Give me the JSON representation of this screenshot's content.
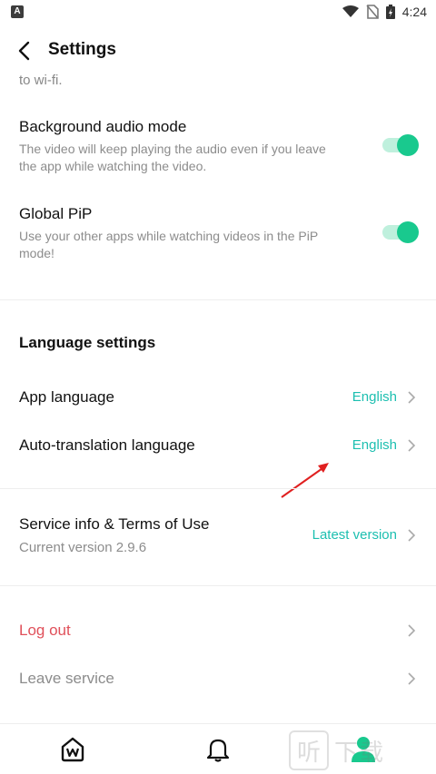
{
  "status_bar": {
    "time": "4:24",
    "left_icon": "A"
  },
  "header": {
    "title": "Settings"
  },
  "cutoff_text": "to wi-fi.",
  "settings": [
    {
      "title": "Background audio mode",
      "desc": "The video will keep playing the audio even if you leave the app while watching the video.",
      "on": true
    },
    {
      "title": "Global PiP",
      "desc": "Use your other apps while watching videos in the PiP mode!",
      "on": true
    }
  ],
  "language": {
    "heading": "Language settings",
    "app_language": {
      "label": "App language",
      "value": "English"
    },
    "auto_translation": {
      "label": "Auto-translation language",
      "value": "English"
    }
  },
  "service": {
    "label": "Service info & Terms of Use",
    "sub": "Current version 2.9.6",
    "value": "Latest version"
  },
  "account": {
    "logout": "Log out",
    "leave": "Leave service"
  },
  "watermark": {
    "box": "听",
    "text": "下载"
  },
  "colors": {
    "accent": "#1cbfb0",
    "toggle": "#19c98e",
    "danger": "#e0505a"
  }
}
